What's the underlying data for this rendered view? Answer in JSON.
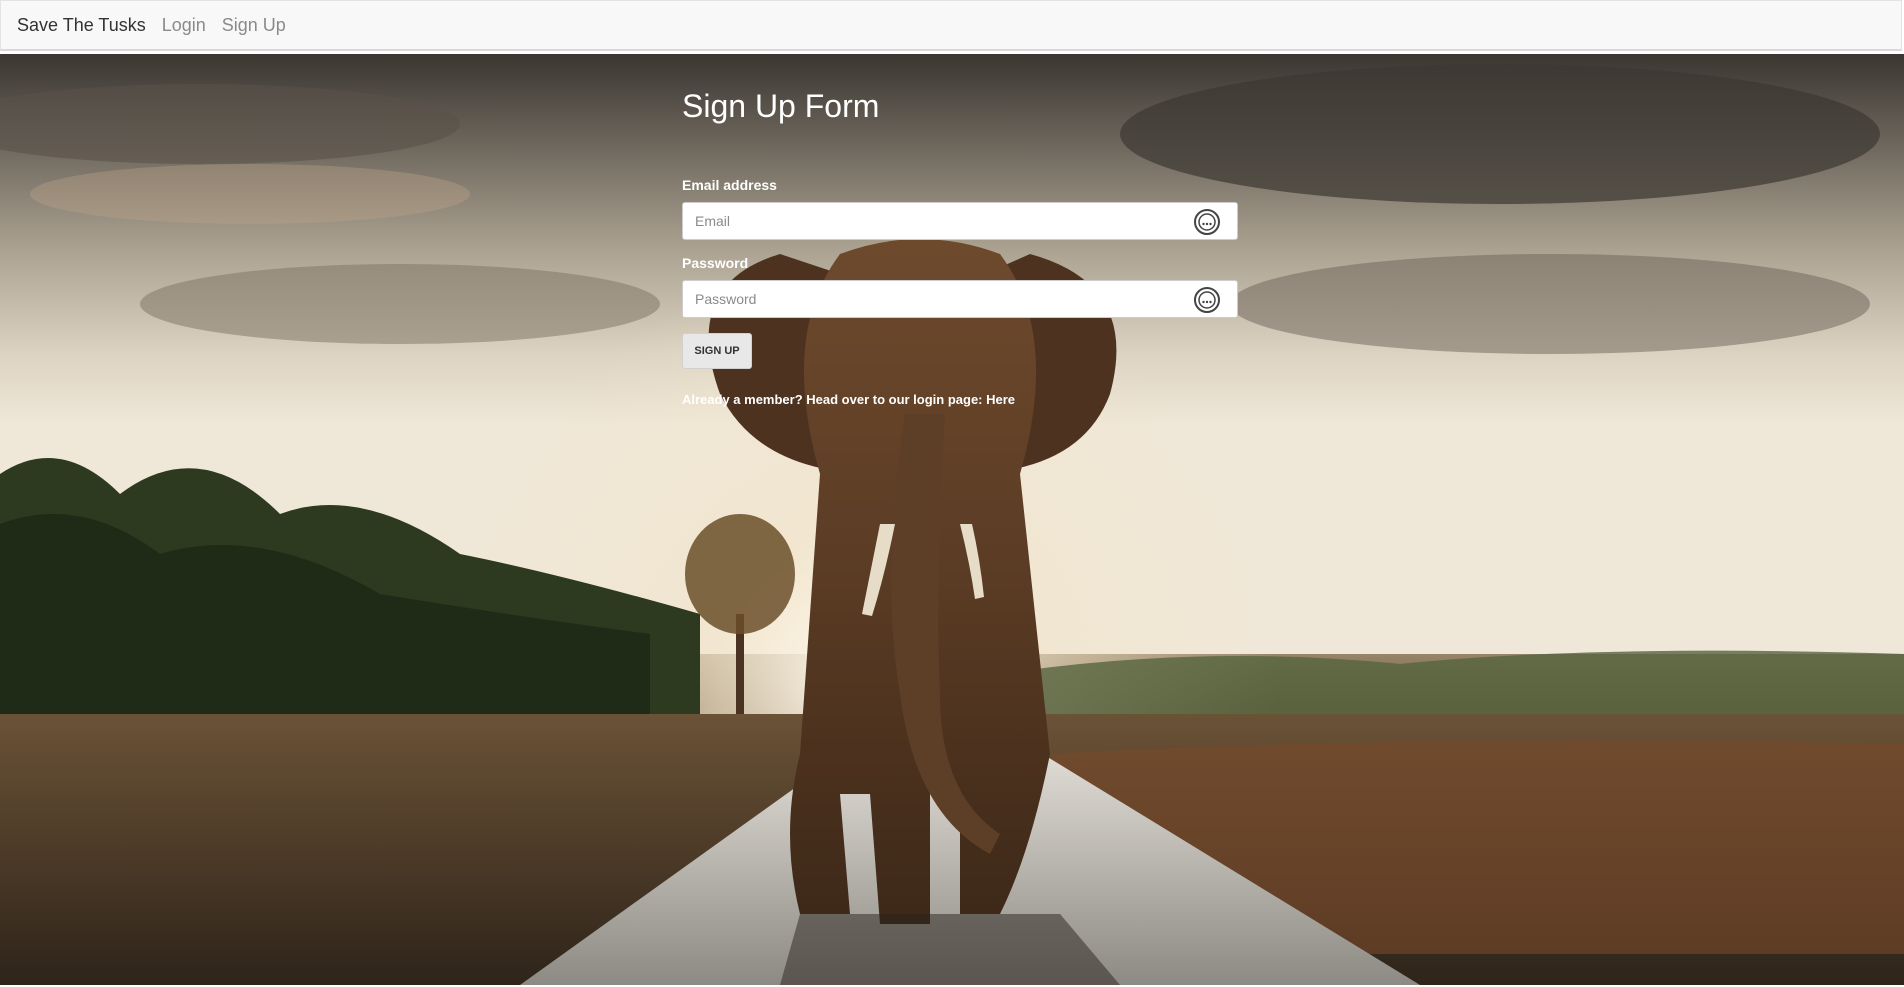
{
  "navbar": {
    "brand": "Save The Tusks",
    "links": [
      {
        "label": "Login"
      },
      {
        "label": "Sign Up"
      }
    ]
  },
  "form": {
    "title": "Sign Up Form",
    "email_label": "Email address",
    "email_placeholder": "Email",
    "email_value": "",
    "password_label": "Password",
    "password_placeholder": "Password",
    "password_value": "",
    "submit_label": "SIGN UP",
    "member_prefix": "Already a member? Head over to our login page: ",
    "member_link": "Here"
  },
  "icons": {
    "field_icon": "password-manager-icon",
    "background": "elephant-on-road-photo"
  },
  "colors": {
    "navbar_bg": "#f8f8f8",
    "brand_text": "#333333",
    "nav_link_text": "#8a8a8a",
    "form_text": "#ffffff",
    "button_bg": "#e8e8e8"
  }
}
